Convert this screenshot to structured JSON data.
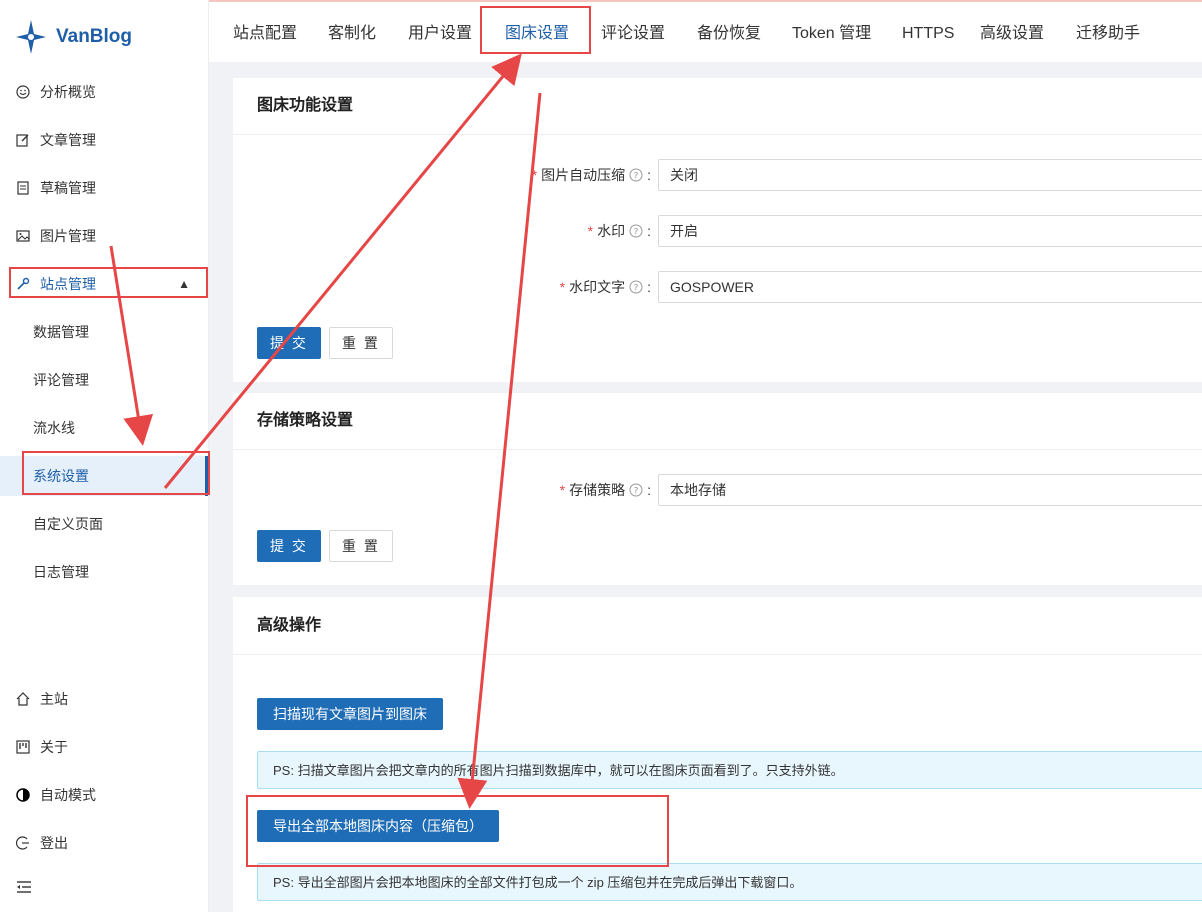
{
  "app": {
    "name": "VanBlog"
  },
  "sidebar": {
    "items": [
      {
        "label": "分析概览",
        "icon": "smile-icon"
      },
      {
        "label": "文章管理",
        "icon": "edit-icon"
      },
      {
        "label": "草稿管理",
        "icon": "container-icon"
      },
      {
        "label": "图片管理",
        "icon": "picture-icon"
      },
      {
        "label": "站点管理",
        "icon": "tool-icon"
      }
    ],
    "sub_items": [
      {
        "label": "数据管理"
      },
      {
        "label": "评论管理"
      },
      {
        "label": "流水线"
      },
      {
        "label": "系统设置"
      },
      {
        "label": "自定义页面"
      },
      {
        "label": "日志管理"
      }
    ],
    "bottom_items": [
      {
        "label": "主站",
        "icon": "home-icon"
      },
      {
        "label": "关于",
        "icon": "project-icon"
      },
      {
        "label": "自动模式",
        "icon": "theme-icon"
      },
      {
        "label": "登出",
        "icon": "logout-icon"
      }
    ]
  },
  "tabs": [
    {
      "label": "站点配置"
    },
    {
      "label": "客制化"
    },
    {
      "label": "用户设置"
    },
    {
      "label": "图床设置"
    },
    {
      "label": "评论设置"
    },
    {
      "label": "备份恢复"
    },
    {
      "label": "Token 管理"
    },
    {
      "label": "HTTPS"
    },
    {
      "label": "高级设置"
    },
    {
      "label": "迁移助手"
    }
  ],
  "image_settings": {
    "title": "图床功能设置",
    "fields": [
      {
        "label": "图片自动压缩",
        "value": "关闭"
      },
      {
        "label": "水印",
        "value": "开启"
      },
      {
        "label": "水印文字",
        "value": "GOSPOWER"
      }
    ],
    "submit_label": "提 交",
    "reset_label": "重 置"
  },
  "storage_settings": {
    "title": "存储策略设置",
    "fields": [
      {
        "label": "存储策略",
        "value": "本地存储"
      }
    ],
    "submit_label": "提 交",
    "reset_label": "重 置"
  },
  "advanced": {
    "title": "高级操作",
    "scan_button": "扫描现有文章图片到图床",
    "scan_note": "PS: 扫描文章图片会把文章内的所有图片扫描到数据库中，就可以在图床页面看到了。只支持外链。",
    "export_button": "导出全部本地图床内容（压缩包）",
    "export_note": "PS: 导出全部图片会把本地图床的全部文件打包成一个 zip 压缩包并在完成后弹出下载窗口。"
  },
  "colors": {
    "primary": "#1f6db6",
    "annotation": "#e64646",
    "info_bg": "#e8f6fd"
  }
}
